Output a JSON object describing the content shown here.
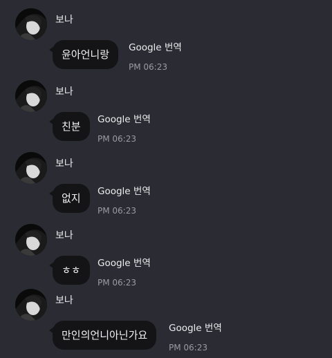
{
  "messages": [
    {
      "sender": "보나",
      "text": "윤아언니랑",
      "translate_label": "Google 번역",
      "time": "PM 06:23"
    },
    {
      "sender": "보나",
      "text": "친분",
      "translate_label": "Google 번역",
      "time": "PM 06:23"
    },
    {
      "sender": "보나",
      "text": "없지",
      "translate_label": "Google 번역",
      "time": "PM 06:23"
    },
    {
      "sender": "보나",
      "text": "ㅎㅎ",
      "translate_label": "Google 번역",
      "time": "PM 06:23"
    },
    {
      "sender": "보나",
      "text": "만인의언니아닌가요",
      "translate_label": "Google 번역",
      "time": "PM 06:23"
    }
  ],
  "colors": {
    "background": "#2b2c33",
    "bubble": "#141417",
    "text": "#f2f2f4",
    "meta": "#9a9ba3"
  },
  "icons": {
    "avatar": "profile-photo"
  }
}
